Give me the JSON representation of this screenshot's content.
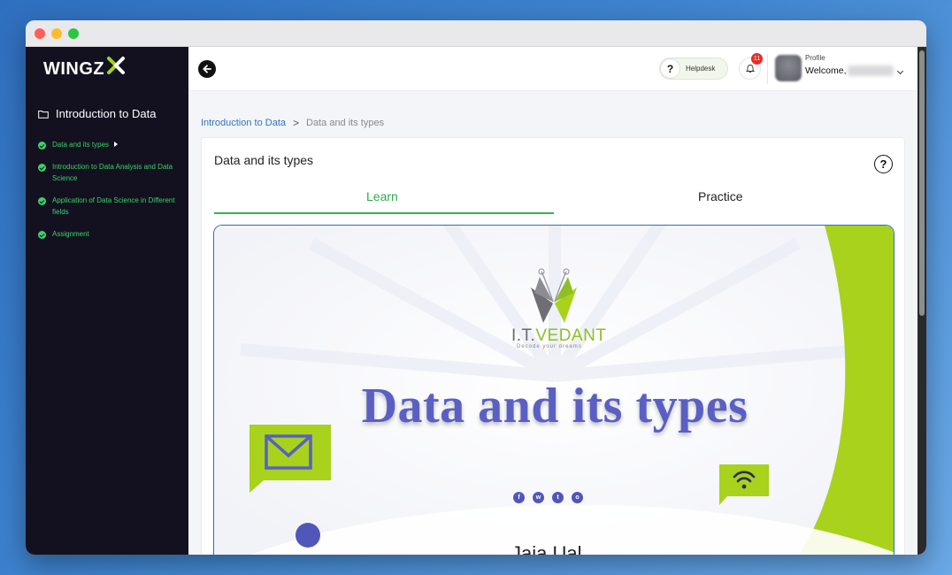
{
  "sidebar": {
    "logo": "WINGZ",
    "course_title": "Introduction to Data",
    "items": [
      {
        "label": "Data and its types",
        "current": true
      },
      {
        "label": "Introduction to Data Analysis and Data Science"
      },
      {
        "label": "Application of Data Science in Different fields"
      },
      {
        "label": "Assignment"
      }
    ]
  },
  "topbar": {
    "helpdesk_label": "Helpdesk",
    "notifications_count": "11",
    "profile_label": "Profile",
    "welcome": "Welcome,"
  },
  "breadcrumb": {
    "parent": "Introduction to Data",
    "separator": ">",
    "current": "Data and its types"
  },
  "card": {
    "title": "Data and its types",
    "help": "?",
    "tabs": [
      {
        "label": "Learn",
        "active": true
      },
      {
        "label": "Practice",
        "active": false
      }
    ]
  },
  "slide": {
    "brand": "I.T.",
    "brand_v": "VEDANT",
    "tagline": "Decode your dreams",
    "heading": "Data and its types",
    "footer_text": "Jaja Ual"
  },
  "colors": {
    "accent_green": "#3ad36b",
    "link_blue": "#2f74c0",
    "slide_purple": "#5a5fc4",
    "lime": "#a8d21c"
  }
}
